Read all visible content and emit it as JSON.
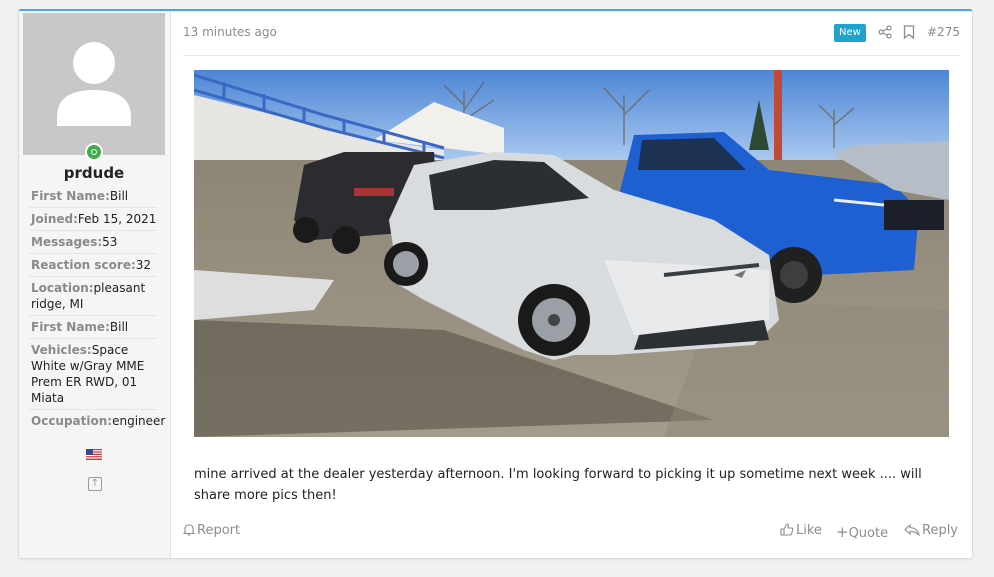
{
  "user": {
    "username": "prdude",
    "fields": [
      {
        "label": "First Name:",
        "value": "Bill"
      },
      {
        "label": "Joined:",
        "value": "Feb 15, 2021"
      },
      {
        "label": "Messages:",
        "value": "53"
      },
      {
        "label": "Reaction score:",
        "value": "32"
      },
      {
        "label": "Location:",
        "value": "pleasant ridge, MI"
      },
      {
        "label": "First Name:",
        "value": "Bill"
      },
      {
        "label": "Vehicles:",
        "value": "Space White w/Gray MME Prem ER RWD, 01 Miata"
      },
      {
        "label": "Occupation:",
        "value": "engineer"
      }
    ],
    "flag_icon": "us-flag-icon",
    "online_color": "#3fae49"
  },
  "post": {
    "time": "13 minutes ago",
    "badge": "New",
    "number": "#275",
    "body": "mine arrived at the dealer yesterday afternoon. I'm looking forward to picking it up sometime next week .... will share more pics then!",
    "actions": {
      "report": "Report",
      "like": "Like",
      "quote": "Quote",
      "reply": "Reply"
    },
    "accent_color": "#47a7eb",
    "badge_color": "#1fa2cc"
  }
}
